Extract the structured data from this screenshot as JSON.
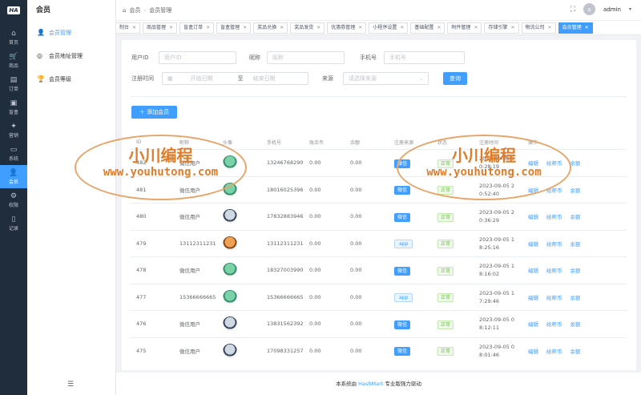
{
  "logo": "HA",
  "nav_rail": [
    {
      "label": "首页",
      "icon": "home-icon",
      "glyph": "⌂"
    },
    {
      "label": "商品",
      "icon": "cart-icon",
      "glyph": "🛒"
    },
    {
      "label": "订单",
      "icon": "order-icon",
      "glyph": "▤"
    },
    {
      "label": "盲盒",
      "icon": "box-icon",
      "glyph": "▣"
    },
    {
      "label": "营销",
      "icon": "marketing-icon",
      "glyph": "✦"
    },
    {
      "label": "系统",
      "icon": "system-icon",
      "glyph": "▭"
    },
    {
      "label": "会员",
      "icon": "member-icon",
      "glyph": "👤"
    },
    {
      "label": "权限",
      "icon": "permission-icon",
      "glyph": "⚙"
    },
    {
      "label": "记录",
      "icon": "record-icon",
      "glyph": "▯"
    }
  ],
  "submenu": {
    "title": "会员",
    "items": [
      {
        "label": "会员管理",
        "glyph": "👤"
      },
      {
        "label": "会员地址管理",
        "glyph": "◎"
      },
      {
        "label": "会员等级",
        "glyph": "🏆"
      }
    ]
  },
  "header": {
    "crumb1": "会员",
    "crumb2": "会员管理",
    "user": "admin",
    "avatar_text": "a"
  },
  "tabs": [
    "制台",
    "商品管理",
    "盲盒订单",
    "盲盒管理",
    "奖品兑换",
    "奖品发货",
    "优惠券管理",
    "小程序设置",
    "基础配置",
    "附件管理",
    "存储引擎",
    "物流公司",
    "会员管理"
  ],
  "filters": {
    "user_id_label": "用户ID",
    "user_id_placeholder": "用户ID",
    "nick_label": "昵称",
    "nick_placeholder": "昵称",
    "phone_label": "手机号",
    "phone_placeholder": "手机号",
    "reg_time_label": "注册时间",
    "start_placeholder": "开始日期",
    "to": "至",
    "end_placeholder": "结束日期",
    "source_label": "来源",
    "source_placeholder": "请选择来源",
    "query_button": "查询"
  },
  "add_button": "＋ 添加会员",
  "table": {
    "headers": [
      "ID",
      "昵称",
      "头像",
      "手机号",
      "账余币",
      "余额",
      "注册来源",
      "状态",
      "注册时间",
      "操作"
    ],
    "op_labels": [
      "编辑",
      "给帮币",
      "余额"
    ],
    "rows": [
      {
        "id": "482",
        "nick": "微信用户",
        "avatar": "green",
        "phone": "13246768290",
        "coins": "0.00",
        "balance": "0.00",
        "source": "微信",
        "status": "正常",
        "time1": "2023-09-06 0",
        "time2": "0:28:19"
      },
      {
        "id": "481",
        "nick": "微信用户",
        "avatar": "green",
        "phone": "18016025396",
        "coins": "0.00",
        "balance": "0.00",
        "source": "微信",
        "status": "正常",
        "time1": "2023-09-05 2",
        "time2": "0:52:40"
      },
      {
        "id": "480",
        "nick": "微信用户",
        "avatar": "white",
        "phone": "17832883946",
        "coins": "0.00",
        "balance": "0.00",
        "source": "微信",
        "status": "正常",
        "time1": "2023-09-05 2",
        "time2": "0:36:29"
      },
      {
        "id": "479",
        "nick": "13112311231",
        "avatar": "orange",
        "phone": "13112311231",
        "coins": "0.00",
        "balance": "0.00",
        "source": "app",
        "status": "正常",
        "time1": "2023-09-05 1",
        "time2": "8:25:16"
      },
      {
        "id": "478",
        "nick": "微信用户",
        "avatar": "green",
        "phone": "18327003990",
        "coins": "0.00",
        "balance": "0.00",
        "source": "微信",
        "status": "正常",
        "time1": "2023-09-05 1",
        "time2": "8:16:02"
      },
      {
        "id": "477",
        "nick": "15366666665",
        "avatar": "green",
        "phone": "15366666665",
        "coins": "0.00",
        "balance": "0.00",
        "source": "app",
        "status": "正常",
        "time1": "2023-09-05 1",
        "time2": "7:29:46"
      },
      {
        "id": "476",
        "nick": "微信用户",
        "avatar": "white",
        "phone": "13831562392",
        "coins": "0.00",
        "balance": "0.00",
        "source": "微信",
        "status": "正常",
        "time1": "2023-09-05 0",
        "time2": "8:12:11"
      },
      {
        "id": "475",
        "nick": "微信用户",
        "avatar": "white",
        "phone": "17098331257",
        "coins": "0.00",
        "balance": "0.00",
        "source": "微信",
        "status": "正常",
        "time1": "2023-09-05 0",
        "time2": "8:01:46"
      }
    ]
  },
  "footer": {
    "prefix": "本系统由 ",
    "brand": "HashMart",
    "suffix": " 专业版强力驱动"
  },
  "watermark": {
    "line1": "小川编程",
    "line2": "www.youhutong.com"
  },
  "colors": {
    "primary": "#409eff",
    "rail": "#1f2d3d",
    "watermark": "#e07d2a"
  }
}
